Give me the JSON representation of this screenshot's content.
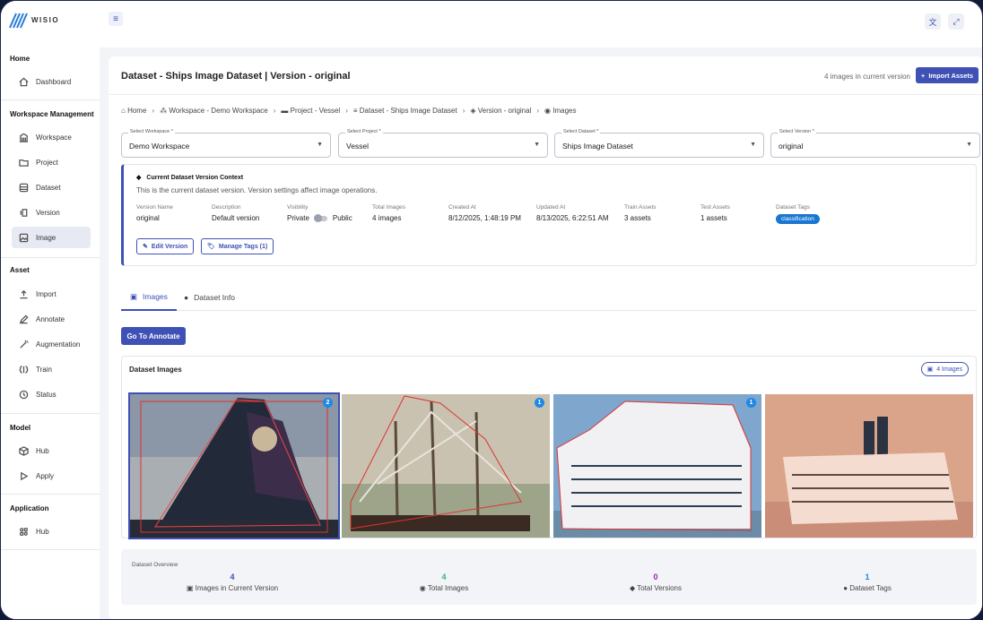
{
  "app": {
    "name": "WISIO"
  },
  "sidebar": {
    "sections": [
      {
        "title": "Home",
        "items": [
          {
            "label": "Dashboard",
            "icon": "home-icon"
          }
        ]
      },
      {
        "title": "Workspace Management",
        "items": [
          {
            "label": "Workspace",
            "icon": "building-icon"
          },
          {
            "label": "Project",
            "icon": "folder-icon"
          },
          {
            "label": "Dataset",
            "icon": "database-icon"
          },
          {
            "label": "Version",
            "icon": "version-icon"
          },
          {
            "label": "Image",
            "icon": "image-icon",
            "active": true
          }
        ]
      },
      {
        "title": "Asset",
        "items": [
          {
            "label": "Import",
            "icon": "upload-icon"
          },
          {
            "label": "Annotate",
            "icon": "pencil-icon"
          },
          {
            "label": "Augmentation",
            "icon": "magic-wand-icon"
          },
          {
            "label": "Train",
            "icon": "brain-icon"
          },
          {
            "label": "Status",
            "icon": "history-icon"
          }
        ]
      },
      {
        "title": "Model",
        "items": [
          {
            "label": "Hub",
            "icon": "cube-icon"
          },
          {
            "label": "Apply",
            "icon": "play-icon"
          }
        ]
      },
      {
        "title": "Application",
        "items": [
          {
            "label": "Hub",
            "icon": "apps-icon"
          }
        ]
      }
    ]
  },
  "header": {
    "title": "Dataset - Ships Image Dataset | Version - original",
    "count_text": "4 images in current version",
    "import_label": "Import Assets"
  },
  "breadcrumbs": [
    "Home",
    "Workspace - Demo Workspace",
    "Project - Vessel",
    "Dataset - Ships Image Dataset",
    "Version - original",
    "Images"
  ],
  "selects": [
    {
      "label": "Select Workspace *",
      "value": "Demo Workspace"
    },
    {
      "label": "Select Project *",
      "value": "Vessel"
    },
    {
      "label": "Select Dataset *",
      "value": "Ships Image Dataset"
    },
    {
      "label": "Select Version *",
      "value": "original"
    }
  ],
  "context": {
    "heading": "Current Dataset Version Context",
    "description": "This is the current dataset version. Version settings affect image operations.",
    "fields": {
      "version_name": {
        "k": "Version Name",
        "v": "original"
      },
      "description": {
        "k": "Description",
        "v": "Default version"
      },
      "visibility": {
        "k": "Visibility",
        "private": "Private",
        "public": "Public"
      },
      "total_images": {
        "k": "Total Images",
        "v": "4 images"
      },
      "created_at": {
        "k": "Created At",
        "v": "8/12/2025, 1:48:19 PM"
      },
      "updated_at": {
        "k": "Updated At",
        "v": "8/13/2025, 6:22:51 AM"
      },
      "train_assets": {
        "k": "Train Assets",
        "v": "3 assets"
      },
      "test_assets": {
        "k": "Test Assets",
        "v": "1 assets"
      },
      "tags": {
        "k": "Dataset Tags",
        "v": "classification"
      }
    },
    "edit_label": "Edit Version",
    "tags_label": "Manage Tags (1)"
  },
  "tabs": [
    {
      "label": "Images",
      "active": true
    },
    {
      "label": "Dataset Info"
    }
  ],
  "goto_label": "Go To Annotate",
  "gallery": {
    "title": "Dataset Images",
    "chip": "4 Images",
    "images": [
      {
        "badge": "2",
        "name": "sailboat-image",
        "selected": true
      },
      {
        "badge": "1",
        "name": "tall-ship-image"
      },
      {
        "badge": "1",
        "name": "cruise-ship-image"
      },
      {
        "badge": "",
        "name": "ferry-image"
      }
    ]
  },
  "overview": {
    "title": "Dataset Overview",
    "stats": [
      {
        "n": "4",
        "label": "Images in Current Version",
        "color": "#3f51b5"
      },
      {
        "n": "4",
        "label": "Total Images",
        "color": "#2eb872"
      },
      {
        "n": "0",
        "label": "Total Versions",
        "color": "#9c27b0"
      },
      {
        "n": "1",
        "label": "Dataset Tags",
        "color": "#1e88e5"
      }
    ]
  },
  "colors": {
    "accent": "#3f51b5",
    "tag": "#1976d2"
  }
}
